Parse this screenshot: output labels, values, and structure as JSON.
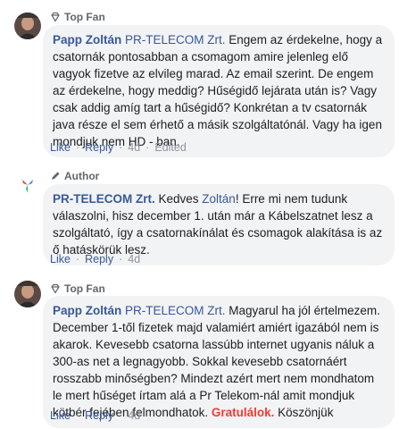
{
  "comments": [
    {
      "badge": "Top Fan",
      "author": "Papp Zoltán",
      "tag": "PR-TELECOM Zrt.",
      "text": " Engem az érdekelne, hogy a csatornák pontosabban a csomagom amire jelenleg elő vagyok fizetve az elvileg marad. Az email szerint. De engem az érdekelne, hogy meddig? Hűségidő lejárata után is? Vagy csak addig amíg tart a hűségidő? Konkrétan a tv csatornák java része el sem érhető a másik szolgáltatónál. Vagy ha igen mondjuk nem HD - ban.",
      "like": "Like",
      "reply": "Reply",
      "time": "4d",
      "edited": "Edited"
    },
    {
      "badge": "Author",
      "author": "PR-TELECOM Zrt.",
      "text_before": " Kedves ",
      "tag": "Zoltán",
      "text_after": "! Erre mi nem tudunk válaszolni, hisz december 1. után már a Kábelszatnet lesz a szolgáltató, így a csatornakínálat és csomagok alakítása is az ő hatáskörük lesz.",
      "like": "Like",
      "reply": "Reply",
      "time": "4d"
    },
    {
      "badge": "Top Fan",
      "author": "Papp Zoltán",
      "tag": "PR-TELECOM Zrt.",
      "text": " Magyarul ha jól értelmezem. December 1-től fizetek majd valamiért amiért igazából nem is akarok. Kevesebb csatorna lassúbb internet ugyanis náluk a 300-as net a legnagyobb. Sokkal kevesebb csatornáért rosszabb minőségben? Mindezt azért mert nem mondhatom le mert hűséget írtam alá a Pr Telekom-nál amit mondjuk kötbér fejében felmondhatok. ",
      "highlight": "Gratulálok.",
      "text_end": " Köszönjük",
      "like": "Like",
      "reply": "Reply",
      "time": "4d"
    }
  ],
  "icons": {
    "top_fan": "diamond-badge-icon",
    "author": "pen-icon"
  },
  "colors": {
    "link": "#385898",
    "muted": "#90949c",
    "bubble": "#f2f3f5",
    "highlight": "#f23b32"
  }
}
